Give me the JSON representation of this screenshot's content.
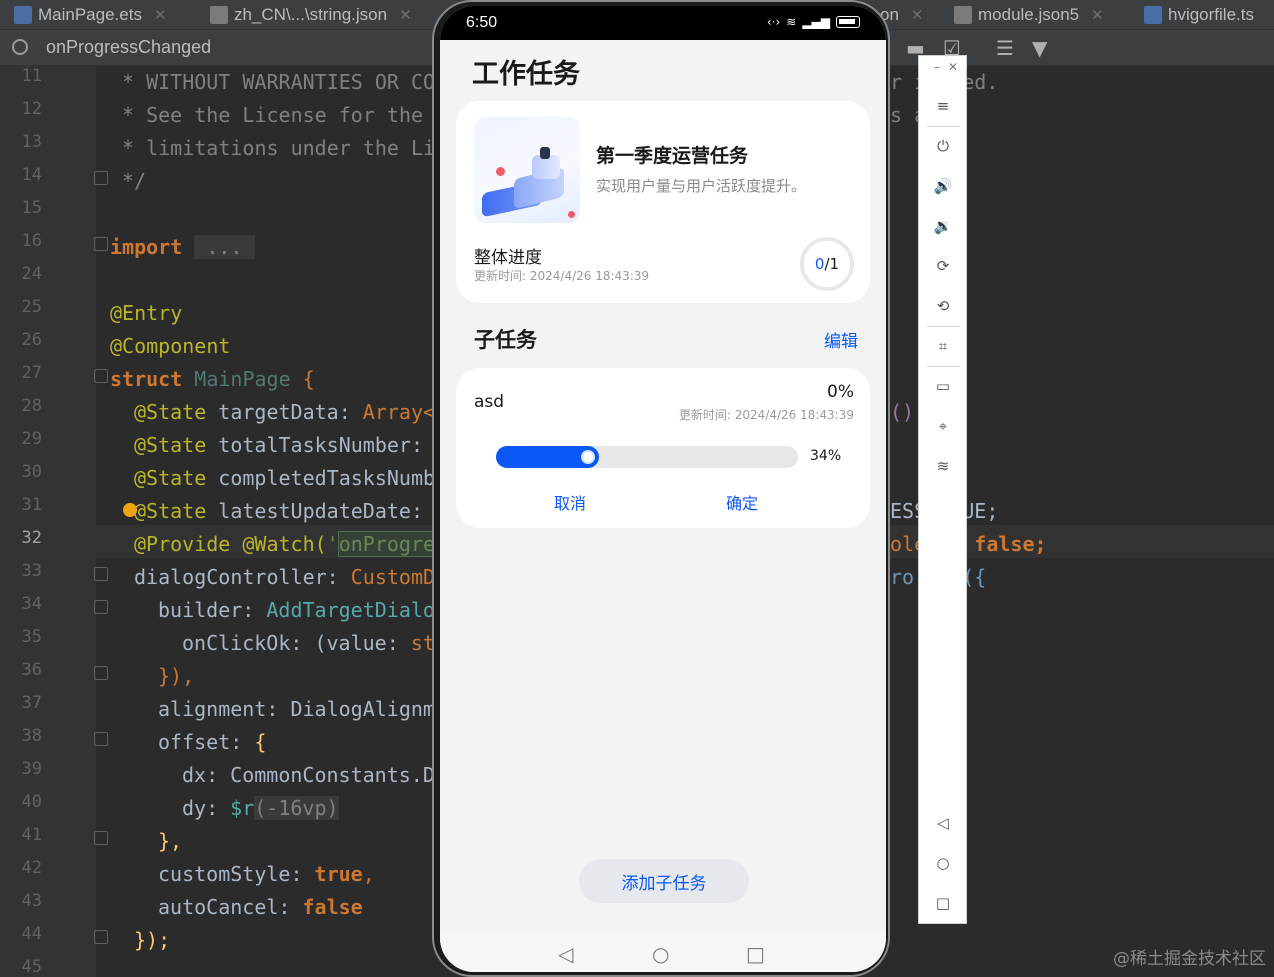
{
  "ide": {
    "tabs": [
      {
        "label": "MainPage.ets",
        "badge": "ETS"
      },
      {
        "label": "zh_CN\\...\\string.json"
      },
      {
        "label": "on"
      },
      {
        "label": "module.json5"
      },
      {
        "label": "hvigorfile.ts",
        "badge": "TS"
      }
    ],
    "search_text": "onProgressChanged",
    "line_numbers": [
      "11",
      "12",
      "13",
      "14",
      "15",
      "16",
      "24",
      "25",
      "26",
      "27",
      "28",
      "29",
      "30",
      "31",
      "32",
      "33",
      "34",
      "35",
      "36",
      "37",
      "38",
      "39",
      "40",
      "41",
      "42",
      "43",
      "44",
      "45"
    ],
    "active_line": "32",
    "code": {
      "l11": "* WITHOUT WARRANTIES OR CO",
      "l12": "* See the License for the ",
      "l13": "* limitations under the Li",
      "l14": "*/",
      "l16_kw": "import",
      "l16_fold": " ... ",
      "l25": "@Entry",
      "l26": "@Component",
      "l27_kw": "struct",
      "l27_name": " MainPage ",
      "l27_brace": "{",
      "l28_an": "@State",
      "l28_rest": " targetData: ",
      "l28_ty": "Array<",
      "l29_an": "@State",
      "l29_rest": " totalTasksNumber:",
      "l30_an": "@State",
      "l30_rest": " completedTasksNumb",
      "l31_an": "@State",
      "l31_rest": " latestUpdateDate:",
      "l32_an": "@Provide @Watch(",
      "l32_st": "'",
      "l32_hl": "onProgre",
      "l33": "dialogController: ",
      "l33_ty": "CustomD",
      "l34": "builder: ",
      "l34_ty": "AddTargetDialo",
      "l35": "onClickOk: (value: ",
      "l35_ty": "st",
      "l36": "}),",
      "l37": "alignment: DialogAlignm",
      "l38": "offset: ",
      "l38_b": "{",
      "l39": "dx: CommonConstants.D",
      "l40_a": "dy: ",
      "l40_b": "$r",
      "l40_c": "(-16vp)",
      "l41": "},",
      "l42_a": "customStyle: ",
      "l42_b": "true",
      "l42_c": ",",
      "l43_a": "autoCancel: ",
      "l43_b": "false",
      "l44": "});",
      "r11": "r i  led.",
      "r12": "s a",
      "r28": "()",
      "r31": "ESS  LUE;",
      "r32_a": "ole  ",
      "r32_b": "= false;",
      "r33": "ro    ({"
    },
    "watermark": "@稀土掘金技术社区"
  },
  "phone": {
    "status_time": "6:50",
    "app_title": "工作任务",
    "task": {
      "title": "第一季度运营任务",
      "desc": "实现用户量与用户活跃度提升。",
      "progress_label": "整体进度",
      "update_time": "更新时间: 2024/4/26 18:43:39",
      "ring_done": "0",
      "ring_total": "/1"
    },
    "subtasks": {
      "header": "子任务",
      "edit": "编辑",
      "item": {
        "name": "asd",
        "percent": "0%",
        "update_time": "更新时间: 2024/4/26 18:43:39",
        "slider_value": "34%",
        "slider_fraction": 0.34,
        "cancel": "取消",
        "confirm": "确定"
      }
    },
    "add_button": "添加子任务"
  },
  "colors": {
    "accent": "#0a59f7",
    "ide_bg": "#2b2b2b"
  },
  "icons": [
    "search-icon",
    "wifi-icon",
    "battery-icon",
    "back-nav-icon",
    "home-nav-icon",
    "recent-nav-icon",
    "power-icon",
    "volume-up-icon",
    "volume-down-icon",
    "rotate-icon",
    "rotate-left-icon",
    "crop-icon",
    "battery-tool-icon",
    "location-icon",
    "wifi-tool-icon",
    "menu-icon",
    "filter-icon"
  ]
}
